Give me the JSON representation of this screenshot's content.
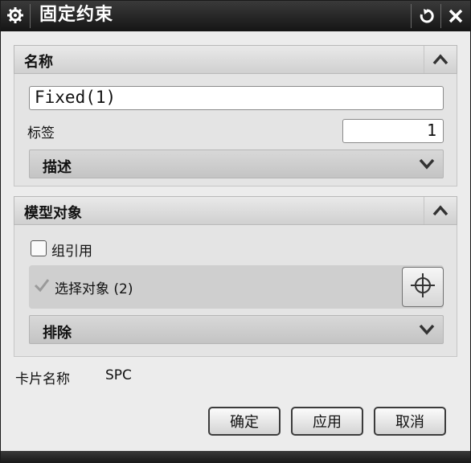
{
  "window": {
    "title": "固定约束"
  },
  "titlebar_icons": {
    "left": "gear-icon",
    "reset": "reset-icon",
    "close": "close-icon"
  },
  "sections": {
    "name": {
      "header": "名称",
      "name_value": "Fixed(1)",
      "tag_label": "标签",
      "tag_value": "1",
      "description_header": "描述"
    },
    "model_objects": {
      "header": "模型对象",
      "group_ref_label": "组引用",
      "group_ref_checked": false,
      "select_objects_label": "选择对象 (2)",
      "exclude_header": "排除"
    }
  },
  "card_name": {
    "label": "卡片名称",
    "value": "SPC"
  },
  "buttons": {
    "ok": "确定",
    "apply": "应用",
    "cancel": "取消"
  }
}
